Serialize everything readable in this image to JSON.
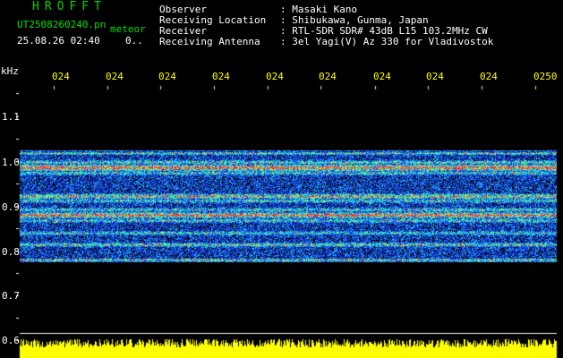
{
  "header": {
    "app_title": "HROFFT",
    "file_name": "UT2508260240.pn",
    "file_suffix": "meteor",
    "datetime": "25.08.26 02:40",
    "counter": "0..",
    "info": [
      {
        "label": "Observer",
        "value": ": Masaki Kano"
      },
      {
        "label": "Receiving Location",
        "value": ": Shibukawa, Gunma, Japan"
      },
      {
        "label": "Receiver",
        "value": ": RTL-SDR SDR# 43dB L15 103.2MHz CW"
      },
      {
        "label": "Receiving Antenna",
        "value": ": 3el Yagi(V) Az 330 for Vladivostok"
      }
    ]
  },
  "axis": {
    "unit": "kHz",
    "y_ticks": [
      "1.1",
      "1.0",
      "0.9",
      "0.8",
      "0.7",
      "0.6"
    ],
    "time_labels": [
      "024",
      "024",
      "024",
      "024",
      "024",
      "024",
      "024",
      "024",
      "024",
      "0250"
    ]
  },
  "colors": {
    "background": "#000000",
    "header_green": "#00e000",
    "header_white": "#ffffff",
    "header_yellow": "#ffff00",
    "noise_blue": "#1030c0",
    "signal_red": "#ff2040",
    "level_bar": "#ffff00"
  }
}
